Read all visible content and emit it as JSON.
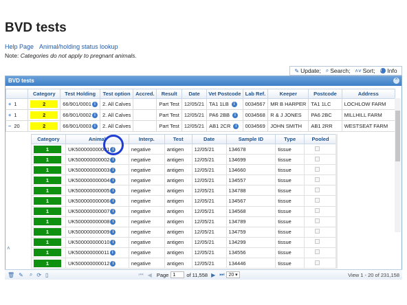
{
  "page": {
    "title": "BVD tests",
    "help_link": "Help Page",
    "lookup_link": "Animal/holding status lookup",
    "note_prefix": "Note: ",
    "note_text": "Categories do not apply to pregnant animals."
  },
  "toolbar": {
    "update": "Update;",
    "search": "Search;",
    "sort": "Sort;",
    "info": "Info"
  },
  "grid": {
    "title": "BVD tests",
    "columns": [
      "Category",
      "Test Holding",
      "Test option",
      "Accred.",
      "Result",
      "Date",
      "Vet Postcode",
      "Lab Ref.",
      "Keeper",
      "Postcode",
      "Address"
    ],
    "rows": [
      {
        "expander": "+",
        "count": "1",
        "category": "2",
        "holding": "66/901/0001",
        "option": "2. All Calves",
        "accred": "",
        "result": "Part Test",
        "date": "12/05/21",
        "vet_postcode": "TA1 1LB",
        "lab_ref": "0034567",
        "keeper": "MR B HARPER",
        "postcode": "TA1 1LC",
        "address": "LOCHLOW FARM"
      },
      {
        "expander": "+",
        "count": "1",
        "category": "2",
        "holding": "66/901/0002",
        "option": "2. All Calves",
        "accred": "",
        "result": "Part Test",
        "date": "12/05/21",
        "vet_postcode": "PA6 2BB",
        "lab_ref": "0034568",
        "keeper": "R & J JONES",
        "postcode": "PA6 2BC",
        "address": "MILLHILL FARM"
      },
      {
        "expander": "−",
        "count": "20",
        "category": "2",
        "holding": "66/901/0003",
        "option": "2. All Calves",
        "accred": "",
        "result": "Part Test",
        "date": "12/05/21",
        "vet_postcode": "AB1 2CR",
        "lab_ref": "0034569",
        "keeper": "JOHN SMITH",
        "postcode": "AB1 2RR",
        "address": "WESTSEAT FARM"
      }
    ]
  },
  "subgrid": {
    "columns": [
      "Category",
      "Animal",
      "Interp.",
      "Test",
      "Date",
      "Sample ID",
      "Type",
      "Pooled"
    ],
    "rows": [
      {
        "category": "1",
        "animal": "UK500000000001",
        "interp": "negative",
        "test": "antigen",
        "date": "12/05/21",
        "sample": "134678",
        "type": "tissue"
      },
      {
        "category": "1",
        "animal": "UK500000000002",
        "interp": "negative",
        "test": "antigen",
        "date": "12/05/21",
        "sample": "134699",
        "type": "tissue"
      },
      {
        "category": "1",
        "animal": "UK500000000003",
        "interp": "negative",
        "test": "antigen",
        "date": "12/05/21",
        "sample": "134660",
        "type": "tissue"
      },
      {
        "category": "1",
        "animal": "UK500000000004",
        "interp": "negative",
        "test": "antigen",
        "date": "12/05/21",
        "sample": "134557",
        "type": "tissue"
      },
      {
        "category": "1",
        "animal": "UK500000000005",
        "interp": "negative",
        "test": "antigen",
        "date": "12/05/21",
        "sample": "134788",
        "type": "tissue"
      },
      {
        "category": "1",
        "animal": "UK500000000006",
        "interp": "negative",
        "test": "antigen",
        "date": "12/05/21",
        "sample": "134567",
        "type": "tissue"
      },
      {
        "category": "1",
        "animal": "UK500000000007",
        "interp": "negative",
        "test": "antigen",
        "date": "12/05/21",
        "sample": "134568",
        "type": "tissue"
      },
      {
        "category": "1",
        "animal": "UK500000000008",
        "interp": "negative",
        "test": "antigen",
        "date": "12/05/21",
        "sample": "134789",
        "type": "tissue"
      },
      {
        "category": "1",
        "animal": "UK500000000009",
        "interp": "negative",
        "test": "antigen",
        "date": "12/05/21",
        "sample": "134759",
        "type": "tissue"
      },
      {
        "category": "1",
        "animal": "UK500000000010",
        "interp": "negative",
        "test": "antigen",
        "date": "12/05/21",
        "sample": "134299",
        "type": "tissue"
      },
      {
        "category": "1",
        "animal": "UK500000000011",
        "interp": "negative",
        "test": "antigen",
        "date": "12/05/21",
        "sample": "134556",
        "type": "tissue"
      },
      {
        "category": "1",
        "animal": "UK500000000012",
        "interp": "negative",
        "test": "antigen",
        "date": "12/05/21",
        "sample": "134446",
        "type": "tissue"
      }
    ]
  },
  "pager": {
    "page_label": "Page",
    "page_value": "1",
    "of_text": "of 11,558",
    "rows_value": "20",
    "view_text": "View 1 - 20 of 231,158"
  },
  "colors": {
    "category_2": "#ffff00",
    "category_1": "#109010",
    "header": "#3d7fc7",
    "highlight_circle": "#1f3dd1"
  }
}
